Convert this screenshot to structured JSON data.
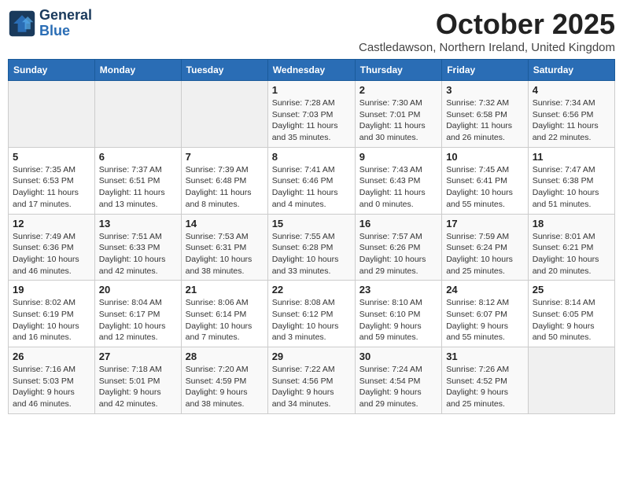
{
  "logo": {
    "line1": "General",
    "line2": "Blue"
  },
  "title": "October 2025",
  "subtitle": "Castledawson, Northern Ireland, United Kingdom",
  "days_of_week": [
    "Sunday",
    "Monday",
    "Tuesday",
    "Wednesday",
    "Thursday",
    "Friday",
    "Saturday"
  ],
  "weeks": [
    [
      {
        "day": "",
        "info": ""
      },
      {
        "day": "",
        "info": ""
      },
      {
        "day": "",
        "info": ""
      },
      {
        "day": "1",
        "info": "Sunrise: 7:28 AM\nSunset: 7:03 PM\nDaylight: 11 hours\nand 35 minutes."
      },
      {
        "day": "2",
        "info": "Sunrise: 7:30 AM\nSunset: 7:01 PM\nDaylight: 11 hours\nand 30 minutes."
      },
      {
        "day": "3",
        "info": "Sunrise: 7:32 AM\nSunset: 6:58 PM\nDaylight: 11 hours\nand 26 minutes."
      },
      {
        "day": "4",
        "info": "Sunrise: 7:34 AM\nSunset: 6:56 PM\nDaylight: 11 hours\nand 22 minutes."
      }
    ],
    [
      {
        "day": "5",
        "info": "Sunrise: 7:35 AM\nSunset: 6:53 PM\nDaylight: 11 hours\nand 17 minutes."
      },
      {
        "day": "6",
        "info": "Sunrise: 7:37 AM\nSunset: 6:51 PM\nDaylight: 11 hours\nand 13 minutes."
      },
      {
        "day": "7",
        "info": "Sunrise: 7:39 AM\nSunset: 6:48 PM\nDaylight: 11 hours\nand 8 minutes."
      },
      {
        "day": "8",
        "info": "Sunrise: 7:41 AM\nSunset: 6:46 PM\nDaylight: 11 hours\nand 4 minutes."
      },
      {
        "day": "9",
        "info": "Sunrise: 7:43 AM\nSunset: 6:43 PM\nDaylight: 11 hours\nand 0 minutes."
      },
      {
        "day": "10",
        "info": "Sunrise: 7:45 AM\nSunset: 6:41 PM\nDaylight: 10 hours\nand 55 minutes."
      },
      {
        "day": "11",
        "info": "Sunrise: 7:47 AM\nSunset: 6:38 PM\nDaylight: 10 hours\nand 51 minutes."
      }
    ],
    [
      {
        "day": "12",
        "info": "Sunrise: 7:49 AM\nSunset: 6:36 PM\nDaylight: 10 hours\nand 46 minutes."
      },
      {
        "day": "13",
        "info": "Sunrise: 7:51 AM\nSunset: 6:33 PM\nDaylight: 10 hours\nand 42 minutes."
      },
      {
        "day": "14",
        "info": "Sunrise: 7:53 AM\nSunset: 6:31 PM\nDaylight: 10 hours\nand 38 minutes."
      },
      {
        "day": "15",
        "info": "Sunrise: 7:55 AM\nSunset: 6:28 PM\nDaylight: 10 hours\nand 33 minutes."
      },
      {
        "day": "16",
        "info": "Sunrise: 7:57 AM\nSunset: 6:26 PM\nDaylight: 10 hours\nand 29 minutes."
      },
      {
        "day": "17",
        "info": "Sunrise: 7:59 AM\nSunset: 6:24 PM\nDaylight: 10 hours\nand 25 minutes."
      },
      {
        "day": "18",
        "info": "Sunrise: 8:01 AM\nSunset: 6:21 PM\nDaylight: 10 hours\nand 20 minutes."
      }
    ],
    [
      {
        "day": "19",
        "info": "Sunrise: 8:02 AM\nSunset: 6:19 PM\nDaylight: 10 hours\nand 16 minutes."
      },
      {
        "day": "20",
        "info": "Sunrise: 8:04 AM\nSunset: 6:17 PM\nDaylight: 10 hours\nand 12 minutes."
      },
      {
        "day": "21",
        "info": "Sunrise: 8:06 AM\nSunset: 6:14 PM\nDaylight: 10 hours\nand 7 minutes."
      },
      {
        "day": "22",
        "info": "Sunrise: 8:08 AM\nSunset: 6:12 PM\nDaylight: 10 hours\nand 3 minutes."
      },
      {
        "day": "23",
        "info": "Sunrise: 8:10 AM\nSunset: 6:10 PM\nDaylight: 9 hours\nand 59 minutes."
      },
      {
        "day": "24",
        "info": "Sunrise: 8:12 AM\nSunset: 6:07 PM\nDaylight: 9 hours\nand 55 minutes."
      },
      {
        "day": "25",
        "info": "Sunrise: 8:14 AM\nSunset: 6:05 PM\nDaylight: 9 hours\nand 50 minutes."
      }
    ],
    [
      {
        "day": "26",
        "info": "Sunrise: 7:16 AM\nSunset: 5:03 PM\nDaylight: 9 hours\nand 46 minutes."
      },
      {
        "day": "27",
        "info": "Sunrise: 7:18 AM\nSunset: 5:01 PM\nDaylight: 9 hours\nand 42 minutes."
      },
      {
        "day": "28",
        "info": "Sunrise: 7:20 AM\nSunset: 4:59 PM\nDaylight: 9 hours\nand 38 minutes."
      },
      {
        "day": "29",
        "info": "Sunrise: 7:22 AM\nSunset: 4:56 PM\nDaylight: 9 hours\nand 34 minutes."
      },
      {
        "day": "30",
        "info": "Sunrise: 7:24 AM\nSunset: 4:54 PM\nDaylight: 9 hours\nand 29 minutes."
      },
      {
        "day": "31",
        "info": "Sunrise: 7:26 AM\nSunset: 4:52 PM\nDaylight: 9 hours\nand 25 minutes."
      },
      {
        "day": "",
        "info": ""
      }
    ]
  ]
}
